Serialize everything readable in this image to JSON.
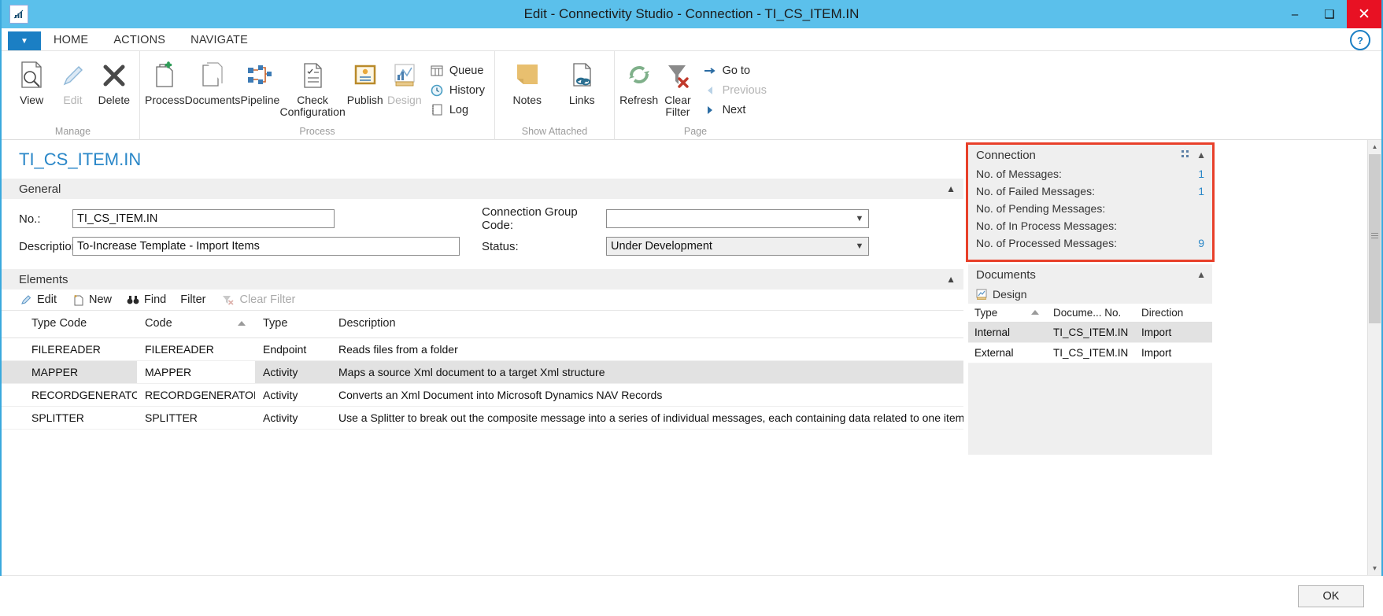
{
  "window": {
    "title": "Edit - Connectivity Studio - Connection - TI_CS_ITEM.IN",
    "app_icon": "chart-app-icon",
    "minimize": "–",
    "maximize": "❑",
    "close": "✕"
  },
  "ribbon": {
    "app_menu": "▼",
    "help": "?",
    "tabs": [
      {
        "label": "HOME",
        "active": true
      },
      {
        "label": "ACTIONS",
        "active": false
      },
      {
        "label": "NAVIGATE",
        "active": false
      }
    ],
    "groups": [
      {
        "label": "Manage",
        "buttons": [
          {
            "label": "View",
            "icon": "page-search-icon",
            "disabled": false
          },
          {
            "label": "Edit",
            "icon": "pencil-icon",
            "disabled": true
          },
          {
            "label": "Delete",
            "icon": "x-delete-icon",
            "disabled": false
          }
        ]
      },
      {
        "label": "Process",
        "buttons": [
          {
            "label": "Process",
            "icon": "process-add-icon",
            "disabled": false
          },
          {
            "label": "Documents",
            "icon": "documents-icon",
            "disabled": false
          },
          {
            "label": "Pipeline",
            "icon": "pipeline-icon",
            "disabled": false
          },
          {
            "label": "Check Configuration",
            "icon": "checklist-page-icon",
            "disabled": false
          },
          {
            "label": "Publish",
            "icon": "publish-certificate-icon",
            "disabled": false
          },
          {
            "label": "Design",
            "icon": "design-chart-icon",
            "disabled": true
          }
        ],
        "small_buttons": [
          {
            "label": "Queue",
            "icon": "queue-icon",
            "disabled": false
          },
          {
            "label": "History",
            "icon": "history-clock-icon",
            "disabled": false
          },
          {
            "label": "Log",
            "icon": "log-icon",
            "disabled": false
          }
        ]
      },
      {
        "label": "Show Attached",
        "buttons": [
          {
            "label": "Notes",
            "icon": "notes-icon",
            "disabled": false
          },
          {
            "label": "Links",
            "icon": "links-icon",
            "disabled": false
          }
        ]
      },
      {
        "label": "Page",
        "buttons": [
          {
            "label": "Refresh",
            "icon": "refresh-icon",
            "disabled": false
          },
          {
            "label": "Clear Filter",
            "icon": "clear-filter-icon",
            "disabled": false
          }
        ],
        "small_buttons": [
          {
            "label": "Go to",
            "icon": "arrow-right-icon",
            "disabled": false
          },
          {
            "label": "Previous",
            "icon": "arrow-left-icon",
            "disabled": true
          },
          {
            "label": "Next",
            "icon": "arrow-right-triangle-icon",
            "disabled": false
          }
        ]
      }
    ]
  },
  "page": {
    "title": "TI_CS_ITEM.IN"
  },
  "general": {
    "header": "General",
    "collapse_icon": "chevron-up-icon",
    "fields": {
      "no_label": "No.:",
      "no_value": "TI_CS_ITEM.IN",
      "description_label": "Description:",
      "description_value": "To-Increase Template - Import Items",
      "connection_group_code_label": "Connection Group Code:",
      "connection_group_code_value": "",
      "status_label": "Status:",
      "status_value": "Under Development"
    }
  },
  "elements": {
    "header": "Elements",
    "collapse_icon": "chevron-up-icon",
    "actions": [
      {
        "label": "Edit",
        "icon": "pencil-icon",
        "disabled": false
      },
      {
        "label": "New",
        "icon": "new-page-icon",
        "disabled": false
      },
      {
        "label": "Find",
        "icon": "binoculars-icon",
        "disabled": false
      },
      {
        "label": "Filter",
        "icon": "",
        "disabled": false
      },
      {
        "label": "Clear Filter",
        "icon": "clear-filter-icon",
        "disabled": true
      }
    ],
    "columns": [
      "Type Code",
      "Code",
      "Type",
      "Description"
    ],
    "sorted_column": "Code",
    "rows": [
      {
        "type_code": "FILEREADER",
        "code": "FILEREADER",
        "type": "Endpoint",
        "description": "Reads files from a folder",
        "selected": false
      },
      {
        "type_code": "MAPPER",
        "code": "MAPPER",
        "type": "Activity",
        "description": "Maps a source Xml document to a target Xml structure",
        "selected": true
      },
      {
        "type_code": "RECORDGENERATOR",
        "code": "RECORDGENERATOR",
        "type": "Activity",
        "description": "Converts an Xml Document into Microsoft Dynamics NAV Records",
        "selected": false
      },
      {
        "type_code": "SPLITTER",
        "code": "SPLITTER",
        "type": "Activity",
        "description": "Use a Splitter to break out the composite message into a series of individual messages, each containing data related to one item.",
        "selected": false
      }
    ]
  },
  "connection_factbox": {
    "header": "Connection",
    "pin_icon": "pin-icon",
    "collapse_icon": "chevron-up-icon",
    "highlighted": true,
    "highlight_color": "#e8402a",
    "rows": [
      {
        "label": "No. of Messages:",
        "value": "1"
      },
      {
        "label": "No. of Failed Messages:",
        "value": "1"
      },
      {
        "label": "No. of Pending Messages:",
        "value": ""
      },
      {
        "label": "No. of In Process Messages:",
        "value": ""
      },
      {
        "label": "No. of Processed Messages:",
        "value": "9"
      }
    ]
  },
  "documents_factbox": {
    "header": "Documents",
    "collapse_icon": "chevron-up-icon",
    "action": {
      "label": "Design",
      "icon": "design-icon"
    },
    "columns": [
      "Type",
      "Docume... No.",
      "Direction"
    ],
    "sorted_column": "Type",
    "rows": [
      {
        "type": "Internal",
        "document_no": "TI_CS_ITEM.IN",
        "direction": "Import",
        "selected": true
      },
      {
        "type": "External",
        "document_no": "TI_CS_ITEM.IN",
        "direction": "Import",
        "selected": false
      }
    ]
  },
  "footer": {
    "ok_label": "OK"
  },
  "scrollbar": {
    "up_arrow": "▲",
    "down_arrow": "▼"
  }
}
